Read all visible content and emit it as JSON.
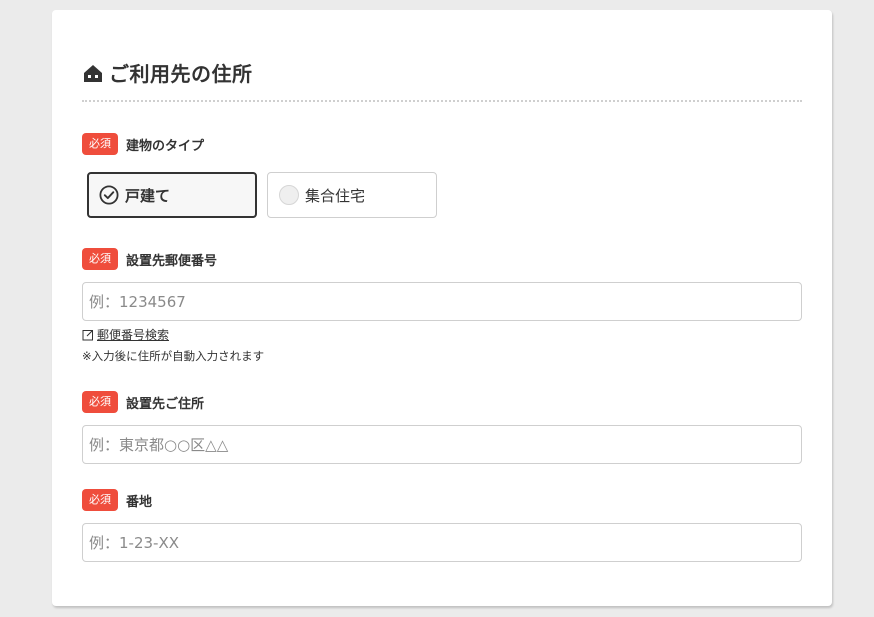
{
  "section": {
    "title": "ご利用先の住所",
    "icon": "house-icon"
  },
  "required_badge": "必須",
  "building_type": {
    "label": "建物のタイプ",
    "options": [
      {
        "label": "戸建て",
        "selected": true
      },
      {
        "label": "集合住宅",
        "selected": false
      }
    ]
  },
  "postal_code": {
    "label": "設置先郵便番号",
    "placeholder": "例：1234567",
    "value": "",
    "search_link": "郵便番号検索",
    "note": "※入力後に住所が自動入力されます"
  },
  "address": {
    "label": "設置先ご住所",
    "placeholder": "例：東京都○○区△△",
    "value": ""
  },
  "street_number": {
    "label": "番地",
    "placeholder": "例：1-23-XX",
    "value": ""
  },
  "colors": {
    "badge": "#ef4d3c",
    "selected_border": "#333333",
    "page_bg": "#ebebeb"
  }
}
